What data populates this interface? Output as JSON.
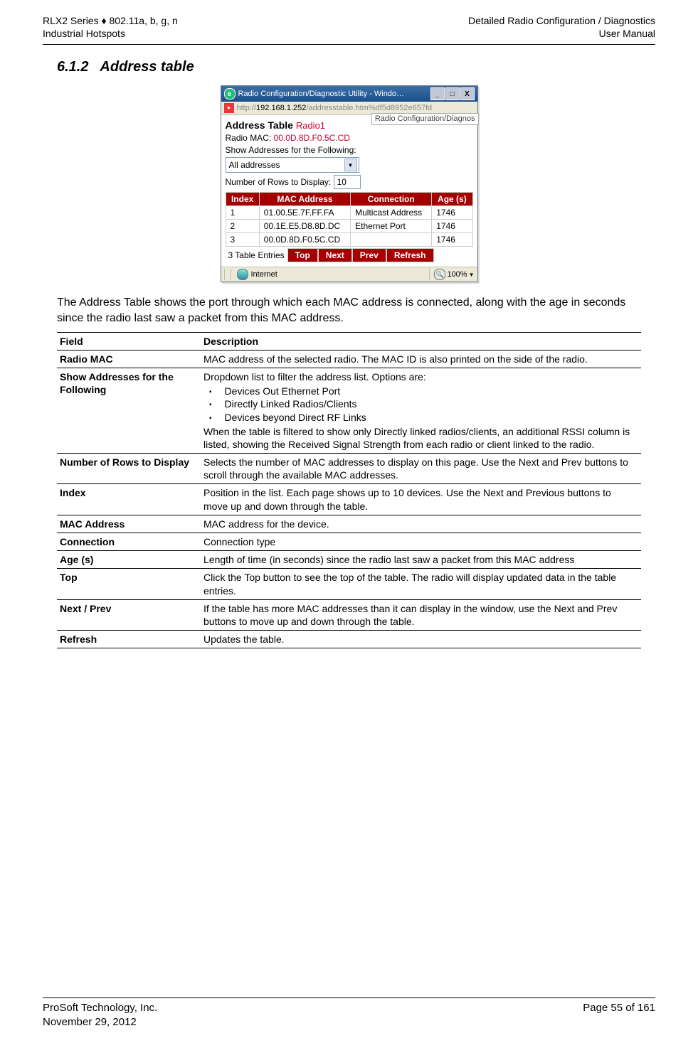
{
  "header": {
    "left_line1": "RLX2 Series ♦ 802.11a, b, g, n",
    "left_line2": "Industrial Hotspots",
    "right_line1": "Detailed Radio Configuration / Diagnostics",
    "right_line2": "User Manual"
  },
  "section": {
    "number": "6.1.2",
    "title": "Address table"
  },
  "screenshot": {
    "window_title": "Radio Configuration/Diagnostic Utility - Windo…",
    "url_prefix": "http://",
    "url_ip": "192.168.1.252",
    "url_rest": "/addresstable.htm%df5d8952e657fd",
    "tab_label": "Radio Configuration/Diagnos",
    "panel_title": "Address Table",
    "radio_label": "Radio1",
    "radio_mac_label": "Radio MAC:",
    "radio_mac_value": "00.0D.8D.F0.5C.CD",
    "show_label": "Show Addresses for the Following:",
    "show_value": "All addresses",
    "rows_label": "Number of Rows to Display:",
    "rows_value": "10",
    "cols": {
      "c1": "Index",
      "c2": "MAC Address",
      "c3": "Connection",
      "c4": "Age (s)"
    },
    "rows": [
      {
        "idx": "1",
        "mac": "01.00.5E.7F.FF.FA",
        "conn": "Multicast Address",
        "age": "1746"
      },
      {
        "idx": "2",
        "mac": "00.1E.E5.D8.8D.DC",
        "conn": "Ethernet Port",
        "age": "1746"
      },
      {
        "idx": "3",
        "mac": "00.0D.8D.F0.5C.CD",
        "conn": "",
        "age": "1746"
      }
    ],
    "entries_label": "3 Table Entries",
    "btn_top": "Top",
    "btn_next": "Next",
    "btn_prev": "Prev",
    "btn_refresh": "Refresh",
    "status_internet": "Internet",
    "status_zoom": "100%"
  },
  "paragraph": "The Address Table shows the port through which each MAC address is connected, along with the age in seconds since the radio last saw a packet from this MAC address.",
  "table_headers": {
    "field": "Field",
    "desc": "Description"
  },
  "rows": [
    {
      "field": "Radio MAC",
      "desc": "MAC address of the selected radio. The MAC ID is also printed on the side of the radio."
    },
    {
      "field": "Show Addresses for the Following",
      "desc_pre": "Dropdown list to filter the address list. Options are:",
      "bullets": [
        "Devices Out Ethernet Port",
        "Directly Linked Radios/Clients",
        "Devices beyond Direct RF Links"
      ],
      "desc_post": "When the table is filtered to show only Directly linked radios/clients, an additional RSSI column is listed, showing the Received Signal Strength from each radio or client linked to the radio."
    },
    {
      "field": "Number of Rows to Display",
      "desc": "Selects the number of MAC addresses to display on this page. Use the Next and Prev buttons to scroll through the available MAC addresses."
    },
    {
      "field": "Index",
      "desc": "Position in the list. Each page shows up to 10 devices. Use the Next and Previous buttons to move up and down through the table."
    },
    {
      "field": "MAC Address",
      "desc": "MAC address for the device."
    },
    {
      "field": "Connection",
      "desc": "Connection type"
    },
    {
      "field": "Age (s)",
      "desc": "Length of time (in seconds) since the radio last saw a packet from this MAC address"
    },
    {
      "field": "Top",
      "desc": "Click the Top button to see the top of the table. The radio will display updated data in the table entries."
    },
    {
      "field": "Next / Prev",
      "desc": "If the table has more MAC addresses than it can display in the window, use the Next and Prev buttons to move up and down through the table."
    },
    {
      "field": "Refresh",
      "desc": "Updates the table."
    }
  ],
  "footer": {
    "left_line1": "ProSoft Technology, Inc.",
    "left_line2": "November 29, 2012",
    "right_line1": "Page 55 of 161"
  }
}
